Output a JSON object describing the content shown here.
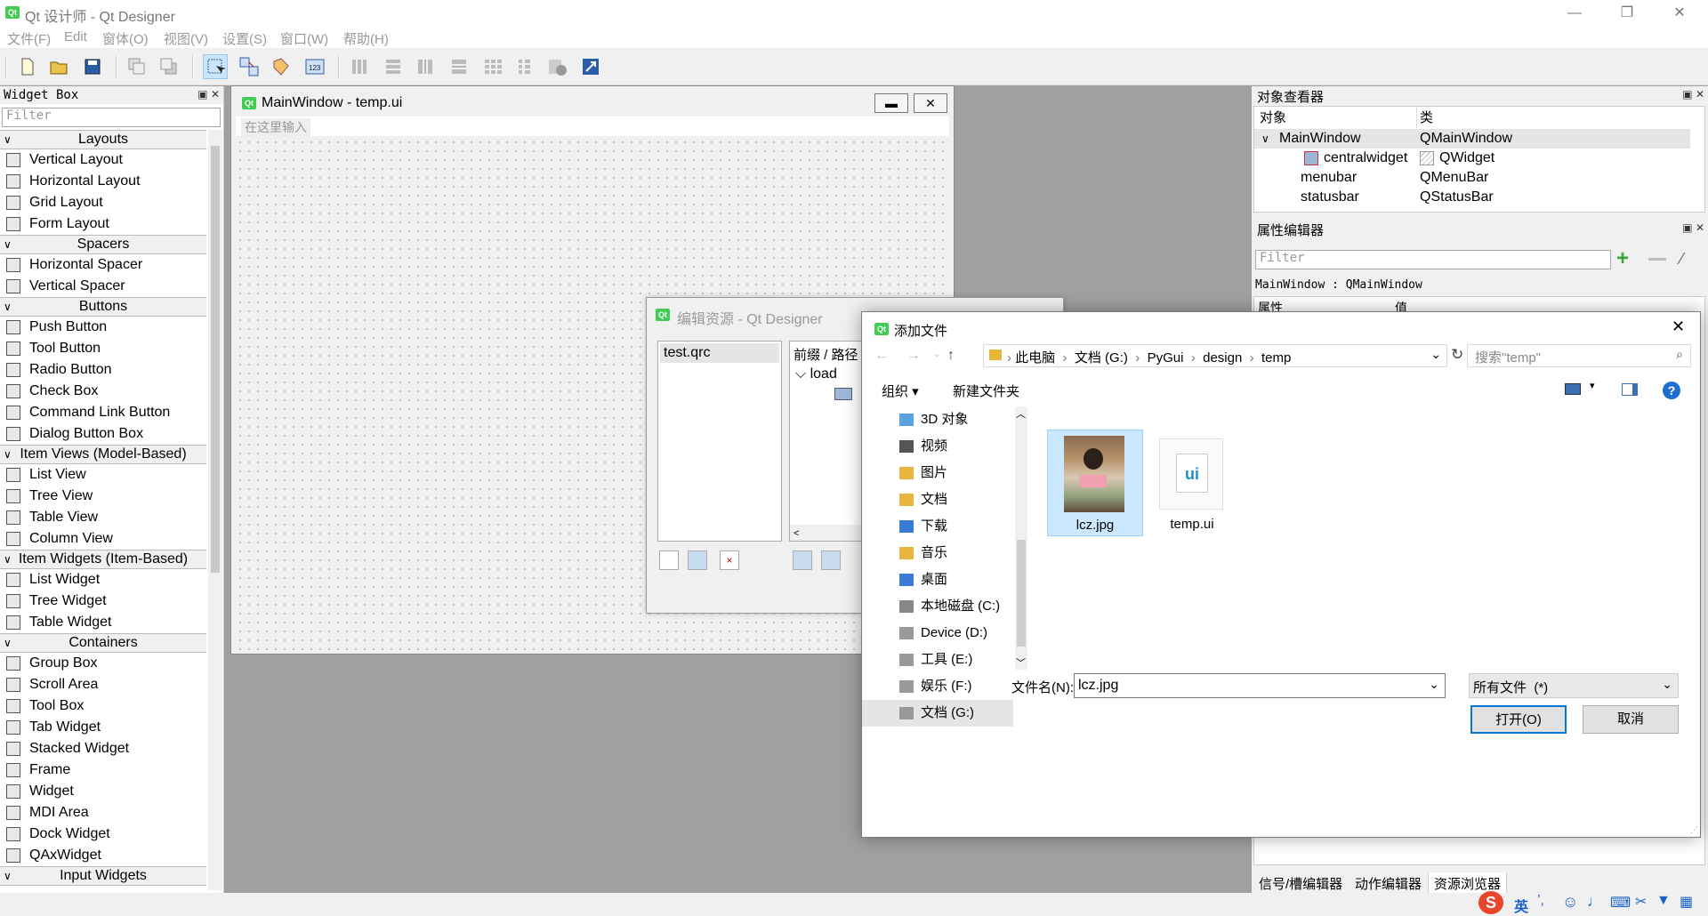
{
  "app": {
    "title": "Qt 设计师 - Qt Designer",
    "logo": "Qt",
    "win_controls": {
      "minimize": "—",
      "restore": "❐",
      "close": "✕"
    }
  },
  "menu": [
    "文件(F)",
    "Edit",
    "窗体(O)",
    "视图(V)",
    "设置(S)",
    "窗口(W)",
    "帮助(H)"
  ],
  "widget_box": {
    "title": "Widget Box",
    "filter_placeholder": "Filter",
    "categories": [
      {
        "name": "Layouts",
        "items": [
          "Vertical Layout",
          "Horizontal Layout",
          "Grid Layout",
          "Form Layout"
        ]
      },
      {
        "name": "Spacers",
        "items": [
          "Horizontal Spacer",
          "Vertical Spacer"
        ]
      },
      {
        "name": "Buttons",
        "items": [
          "Push Button",
          "Tool Button",
          "Radio Button",
          "Check Box",
          "Command Link Button",
          "Dialog Button Box"
        ]
      },
      {
        "name": "Item Views (Model-Based)",
        "items": [
          "List View",
          "Tree View",
          "Table View",
          "Column View"
        ]
      },
      {
        "name": "Item Widgets (Item-Based)",
        "items": [
          "List Widget",
          "Tree Widget",
          "Table Widget"
        ]
      },
      {
        "name": "Containers",
        "items": [
          "Group Box",
          "Scroll Area",
          "Tool Box",
          "Tab Widget",
          "Stacked Widget",
          "Frame",
          "Widget",
          "MDI Area",
          "Dock Widget",
          "QAxWidget"
        ]
      },
      {
        "name": "Input Widgets",
        "items": []
      }
    ]
  },
  "form_window": {
    "title": "MainWindow - temp.ui",
    "menu_placeholder": "在这里输入"
  },
  "resource_editor": {
    "title": "编辑资源 - Qt Designer",
    "file": "test.qrc",
    "prefix_header": "前缀 / 路径",
    "prefix": "load"
  },
  "object_inspector": {
    "title": "对象查看器",
    "col_object": "对象",
    "col_class": "类",
    "rows": [
      {
        "name": "MainWindow",
        "cls": "QMainWindow"
      },
      {
        "name": "centralwidget",
        "cls": "QWidget"
      },
      {
        "name": "menubar",
        "cls": "QMenuBar"
      },
      {
        "name": "statusbar",
        "cls": "QStatusBar"
      }
    ]
  },
  "property_editor": {
    "title": "属性编辑器",
    "filter_placeholder": "Filter",
    "context": "MainWindow : QMainWindow",
    "col_prop": "属性",
    "col_value": "值"
  },
  "bottom_tabs": [
    "信号/槽编辑器",
    "动作编辑器",
    "资源浏览器"
  ],
  "file_dialog": {
    "title": "添加文件",
    "breadcrumb": [
      "此电脑",
      "文档 (G:)",
      "PyGui",
      "design",
      "temp"
    ],
    "search_placeholder": "搜索\"temp\"",
    "organize": "组织 ▾",
    "new_folder": "新建文件夹",
    "nav": [
      "3D 对象",
      "视频",
      "图片",
      "文档",
      "下载",
      "音乐",
      "桌面",
      "本地磁盘 (C:)",
      "Device (D:)",
      "工具 (E:)",
      "娱乐 (F:)",
      "文档 (G:)"
    ],
    "files": [
      {
        "name": "lcz.jpg",
        "selected": true
      },
      {
        "name": "temp.ui",
        "selected": false
      }
    ],
    "filename_label": "文件名(N):",
    "filename_value": "lcz.jpg",
    "filter_value": "所有文件  (*)",
    "open_label": "打开(O)",
    "cancel_label": "取消"
  },
  "ime": {
    "lang": "英",
    "brand_color": "#e8452c"
  }
}
